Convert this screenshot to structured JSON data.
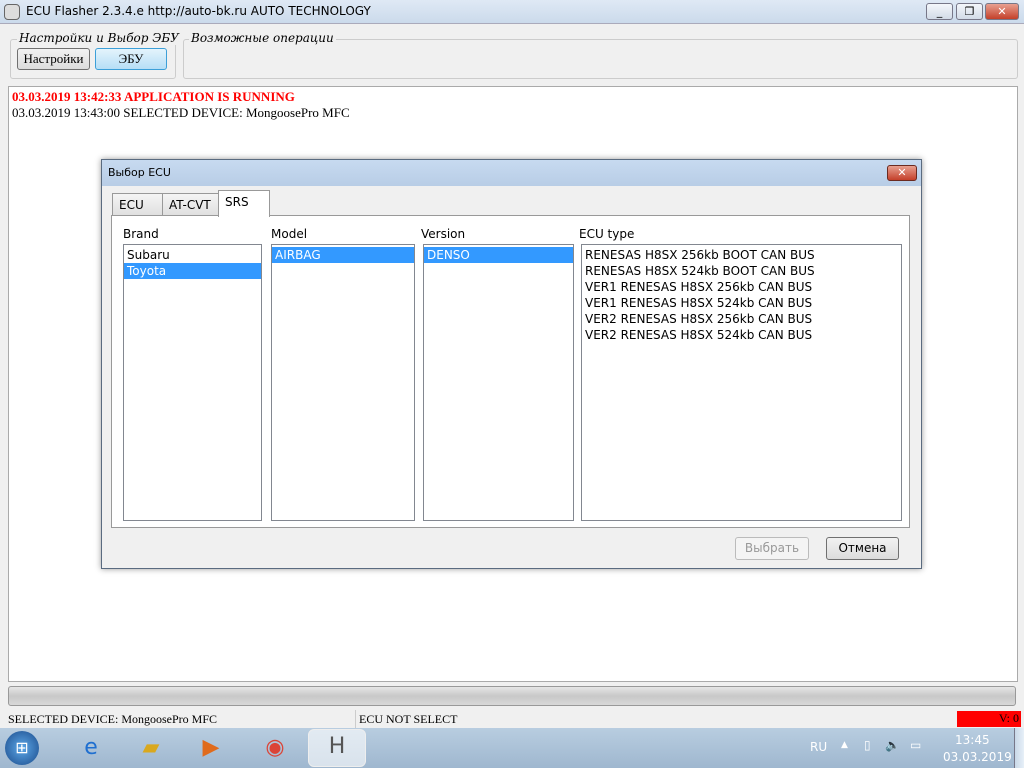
{
  "window": {
    "title": "ECU Flasher 2.3.4.e http://auto-bk.ru  AUTO TECHNOLOGY",
    "minimize": "_",
    "maximize": "❐",
    "close": "✕"
  },
  "toolbar": {
    "group1_label": "Настройки и Выбор ЭБУ",
    "settings_button": "Настройки",
    "ecu_button": "ЭБУ",
    "group2_label": "Возможные операции"
  },
  "log": [
    {
      "text": "03.03.2019 13:42:33 APPLICATION IS RUNNING"
    },
    {
      "text": "03.03.2019 13:43:00 SELECTED DEVICE: MongoosePro MFC"
    }
  ],
  "dialog": {
    "title": "Выбор ECU",
    "close": "✕",
    "tabs": [
      "ECU",
      "AT-CVT",
      "SRS"
    ],
    "active_tab": "SRS",
    "brand": {
      "label": "Brand",
      "items": [
        "Subaru",
        "Toyota"
      ],
      "selected": "Toyota"
    },
    "model": {
      "label": "Model",
      "items": [
        "AIRBAG"
      ],
      "selected": "AIRBAG"
    },
    "version": {
      "label": "Version",
      "items": [
        "DENSO"
      ],
      "selected": "DENSO"
    },
    "ecu_type": {
      "label": "ECU type",
      "items": [
        "RENESAS H8SX 256kb BOOT CAN BUS",
        "RENESAS H8SX 524kb BOOT CAN BUS",
        "VER1 RENESAS H8SX 256kb CAN BUS",
        "VER1 RENESAS H8SX 524kb CAN BUS",
        "VER2 RENESAS H8SX 256kb CAN BUS",
        "VER2 RENESAS H8SX 524kb CAN BUS"
      ]
    },
    "select_button": "Выбрать",
    "cancel_button": "Отмена"
  },
  "progress": {
    "value": 0
  },
  "status": {
    "device": "SELECTED DEVICE: MongoosePro MFC",
    "ecu": "ECU NOT SELECT",
    "version": "V: 0",
    "version_color": "#ff0000"
  },
  "taskbar": {
    "language": "RU",
    "time": "13:45",
    "date": "03.03.2019"
  }
}
